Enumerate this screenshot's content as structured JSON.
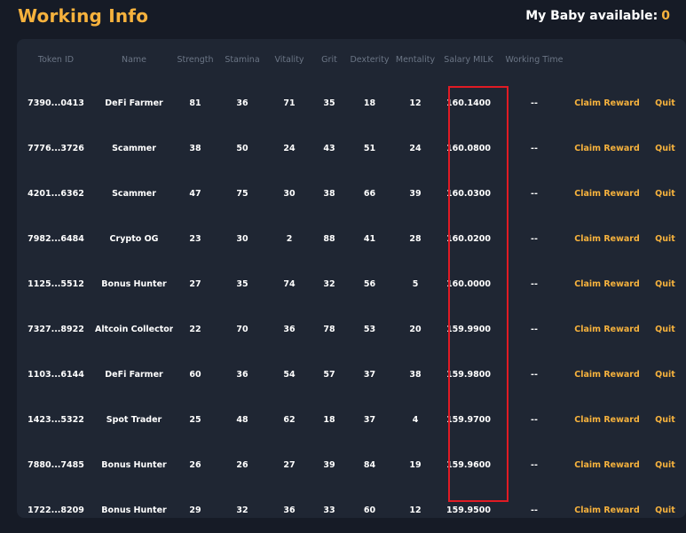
{
  "header": {
    "title": "Working Info",
    "baby_label": "My Baby available:",
    "baby_count": "0"
  },
  "table": {
    "columns": [
      "Token ID",
      "Name",
      "Strength",
      "Stamina",
      "Vitality",
      "Grit",
      "Dexterity",
      "Mentality",
      "Salary MILK",
      "Working Time",
      "",
      ""
    ],
    "rows": [
      {
        "token": "7390...0413",
        "name": "DeFi Farmer",
        "strength": "81",
        "stamina": "36",
        "vitality": "71",
        "grit": "35",
        "dexterity": "18",
        "mentality": "12",
        "salary": "160.1400",
        "time": "--",
        "claim": "Claim Reward",
        "quit": "Quit"
      },
      {
        "token": "7776...3726",
        "name": "Scammer",
        "strength": "38",
        "stamina": "50",
        "vitality": "24",
        "grit": "43",
        "dexterity": "51",
        "mentality": "24",
        "salary": "160.0800",
        "time": "--",
        "claim": "Claim Reward",
        "quit": "Quit"
      },
      {
        "token": "4201...6362",
        "name": "Scammer",
        "strength": "47",
        "stamina": "75",
        "vitality": "30",
        "grit": "38",
        "dexterity": "66",
        "mentality": "39",
        "salary": "160.0300",
        "time": "--",
        "claim": "Claim Reward",
        "quit": "Quit"
      },
      {
        "token": "7982...6484",
        "name": "Crypto OG",
        "strength": "23",
        "stamina": "30",
        "vitality": "2",
        "grit": "88",
        "dexterity": "41",
        "mentality": "28",
        "salary": "160.0200",
        "time": "--",
        "claim": "Claim Reward",
        "quit": "Quit"
      },
      {
        "token": "1125...5512",
        "name": "Bonus Hunter",
        "strength": "27",
        "stamina": "35",
        "vitality": "74",
        "grit": "32",
        "dexterity": "56",
        "mentality": "5",
        "salary": "160.0000",
        "time": "--",
        "claim": "Claim Reward",
        "quit": "Quit"
      },
      {
        "token": "7327...8922",
        "name": "Altcoin Collector",
        "strength": "22",
        "stamina": "70",
        "vitality": "36",
        "grit": "78",
        "dexterity": "53",
        "mentality": "20",
        "salary": "159.9900",
        "time": "--",
        "claim": "Claim Reward",
        "quit": "Quit"
      },
      {
        "token": "1103...6144",
        "name": "DeFi Farmer",
        "strength": "60",
        "stamina": "36",
        "vitality": "54",
        "grit": "57",
        "dexterity": "37",
        "mentality": "38",
        "salary": "159.9800",
        "time": "--",
        "claim": "Claim Reward",
        "quit": "Quit"
      },
      {
        "token": "1423...5322",
        "name": "Spot Trader",
        "strength": "25",
        "stamina": "48",
        "vitality": "62",
        "grit": "18",
        "dexterity": "37",
        "mentality": "4",
        "salary": "159.9700",
        "time": "--",
        "claim": "Claim Reward",
        "quit": "Quit"
      },
      {
        "token": "7880...7485",
        "name": "Bonus Hunter",
        "strength": "26",
        "stamina": "26",
        "vitality": "27",
        "grit": "39",
        "dexterity": "84",
        "mentality": "19",
        "salary": "159.9600",
        "time": "--",
        "claim": "Claim Reward",
        "quit": "Quit"
      },
      {
        "token": "1722...8209",
        "name": "Bonus Hunter",
        "strength": "29",
        "stamina": "32",
        "vitality": "36",
        "grit": "33",
        "dexterity": "60",
        "mentality": "12",
        "salary": "159.9500",
        "time": "--",
        "claim": "Claim Reward",
        "quit": "Quit"
      }
    ]
  }
}
